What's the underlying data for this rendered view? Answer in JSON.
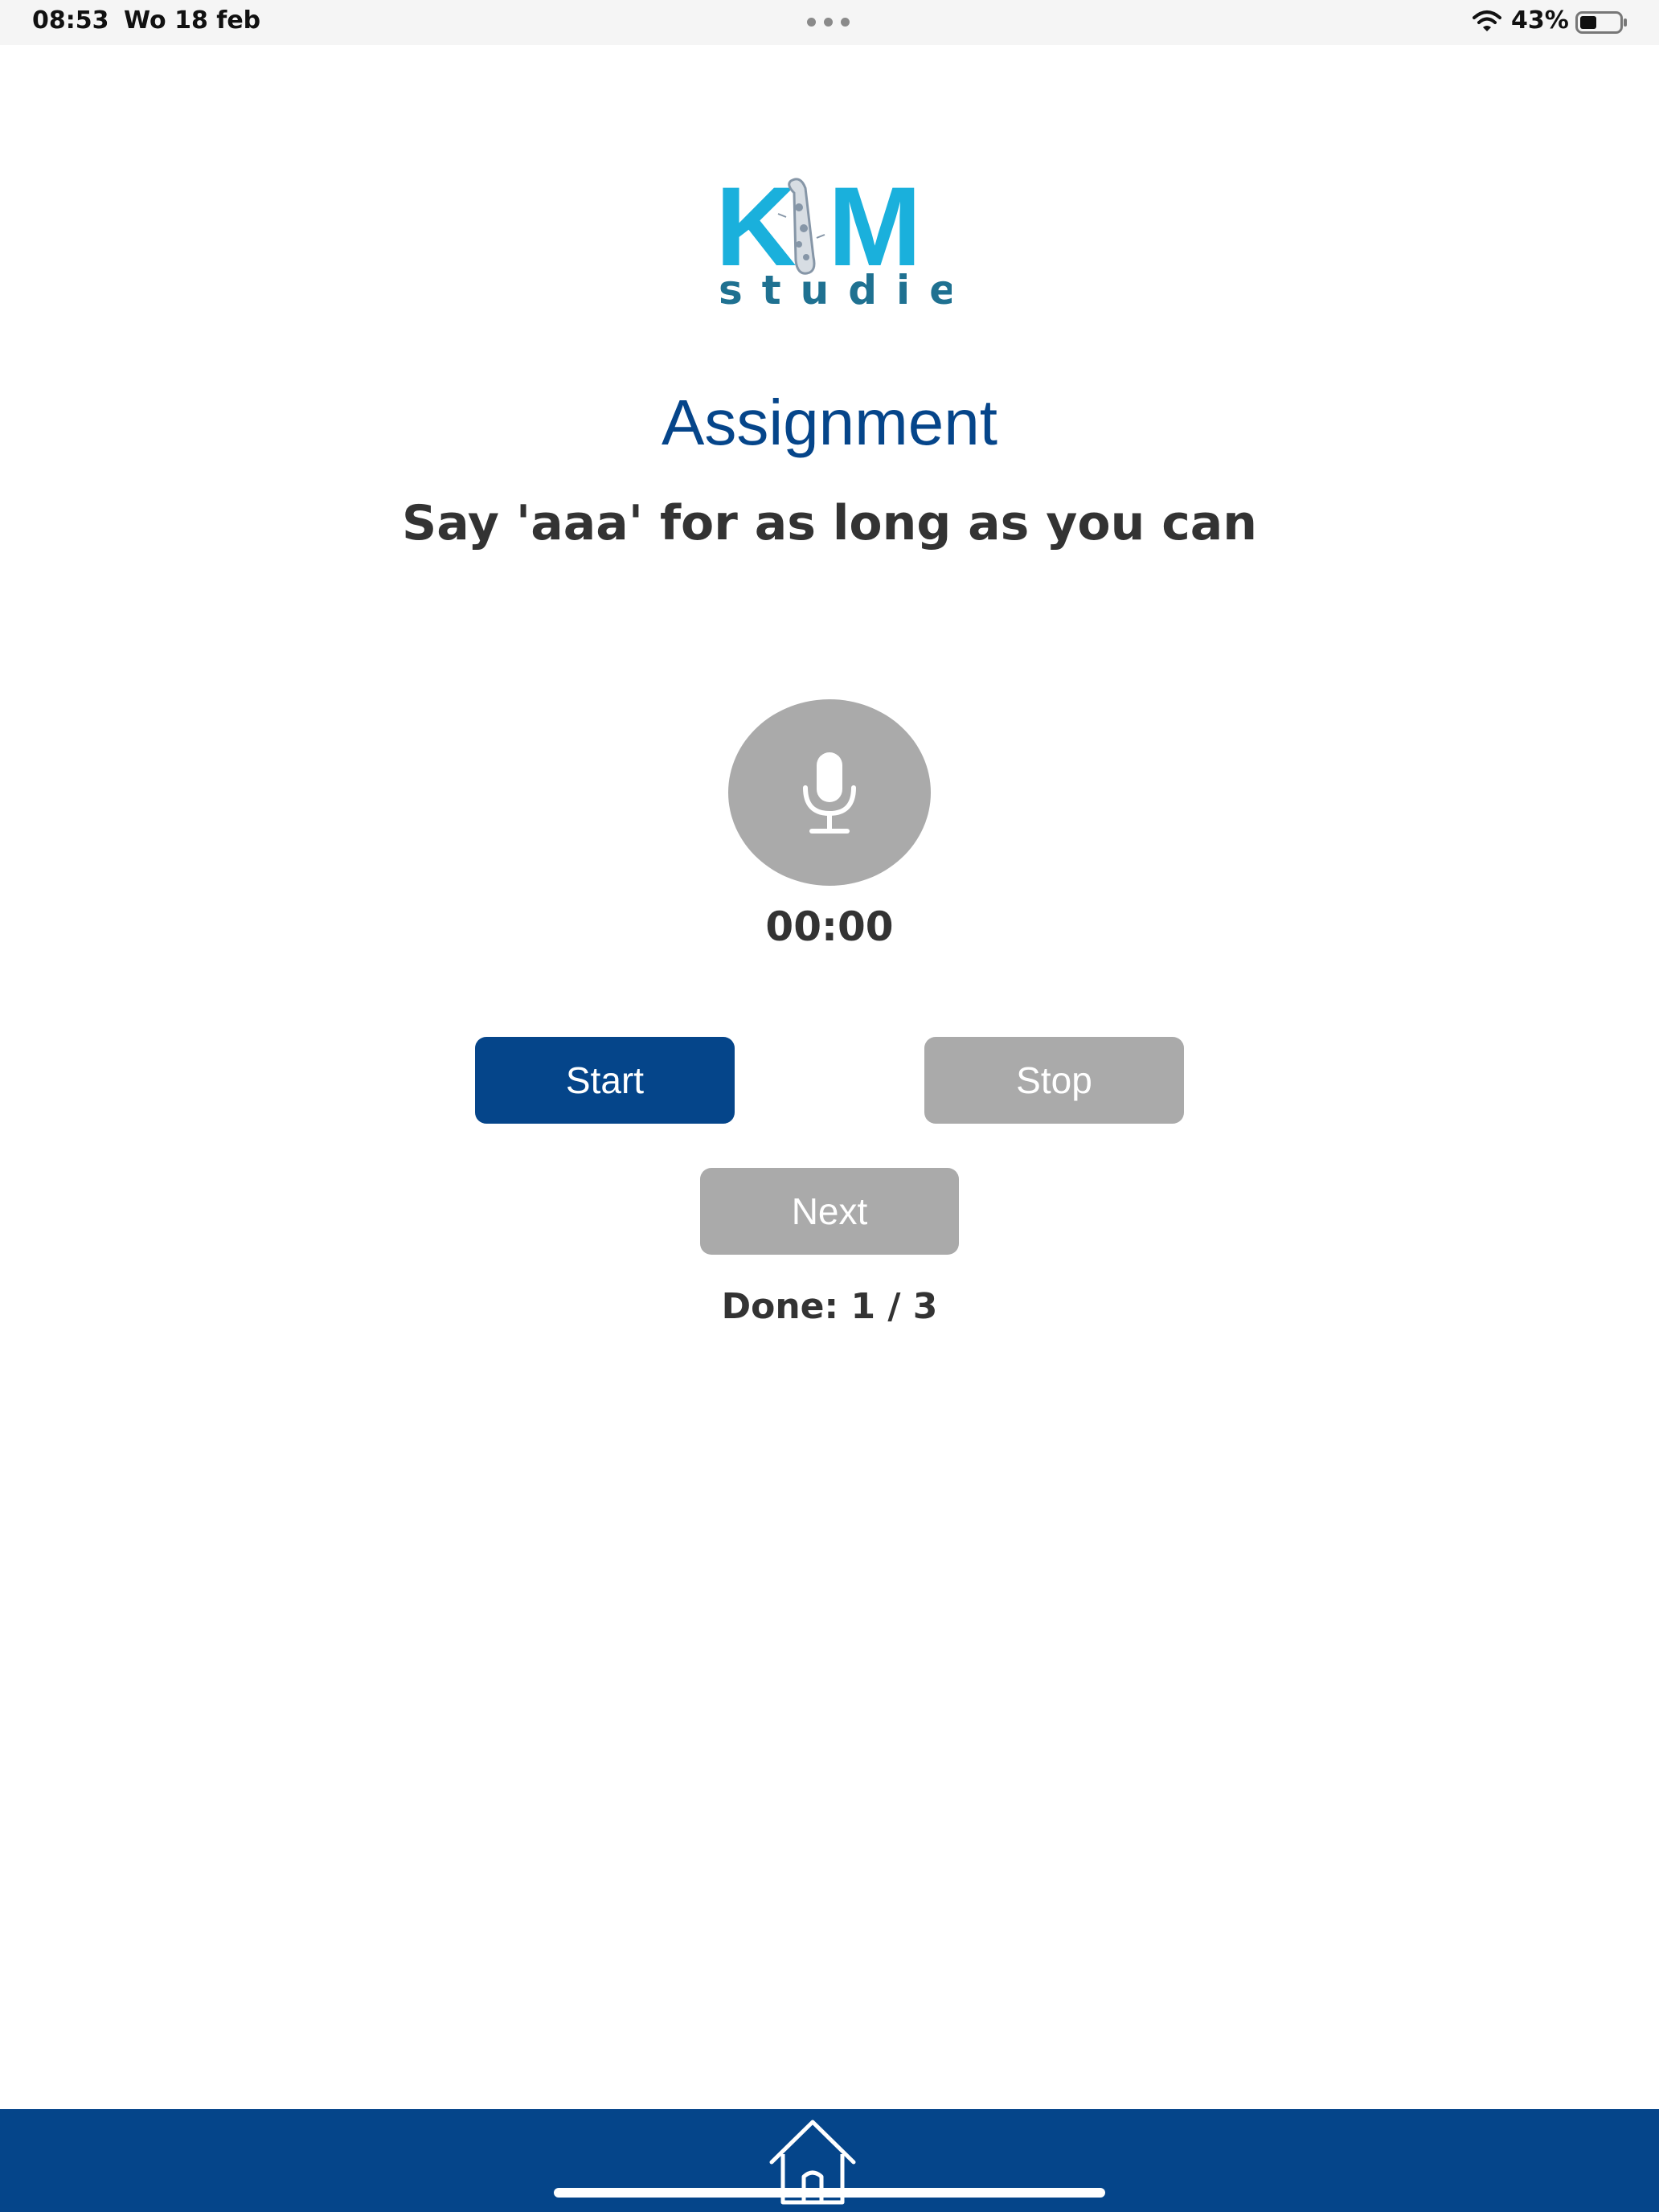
{
  "status_bar": {
    "time": "08:53",
    "date": "Wo 18 feb",
    "battery_percent": "43%",
    "battery_level": 0.43,
    "icons": [
      "more-dots-icon",
      "wifi-icon",
      "battery-icon"
    ]
  },
  "logo": {
    "text_top_left": "K",
    "text_top_right": "M",
    "text_bottom": "studie"
  },
  "main": {
    "title": "Assignment",
    "instruction": "Say 'aaa' for as long as you can",
    "mic_icon": "microphone-icon",
    "timer": "00:00"
  },
  "buttons": {
    "start_label": "Start",
    "stop_label": "Stop",
    "next_label": "Next"
  },
  "progress": {
    "text": "Done: 1 / 3"
  },
  "bottom_nav": {
    "home_icon": "home-icon"
  },
  "colors": {
    "brand_blue": "#05458a",
    "logo_cyan": "#1ab0dc",
    "logo_teal": "#1f7191",
    "disabled_gray": "#aaaaaa",
    "text_dark": "#333333"
  }
}
